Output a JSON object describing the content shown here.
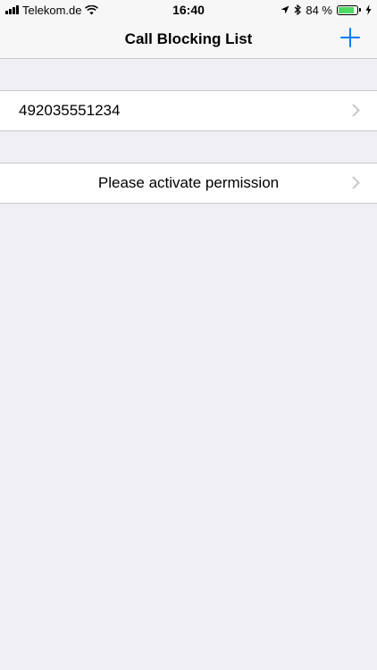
{
  "status_bar": {
    "carrier": "Telekom.de",
    "time": "16:40",
    "battery_percent_text": "84 %",
    "battery_level": 0.84,
    "battery_color": "#4cd964"
  },
  "nav": {
    "title": "Call Blocking List",
    "add_icon": "plus-icon",
    "accent_color": "#007aff"
  },
  "list": {
    "numbers": [
      "492035551234"
    ]
  },
  "permission": {
    "label": "Please activate permission"
  }
}
